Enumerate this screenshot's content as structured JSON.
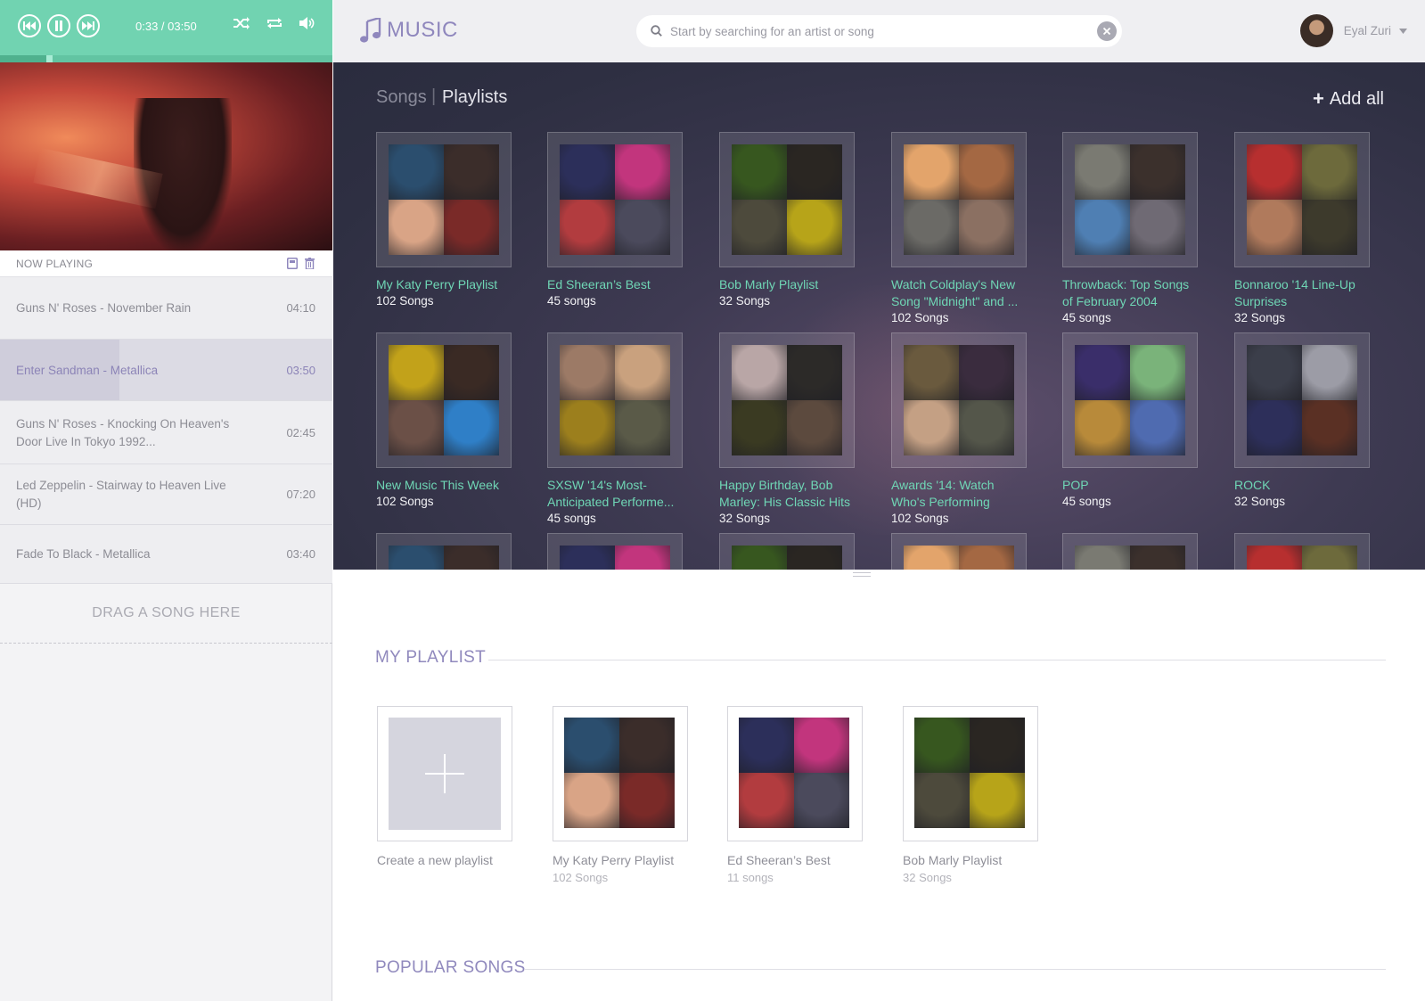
{
  "player": {
    "time": "0:33 / 03:50",
    "progress": 0.14
  },
  "now_playing": {
    "label": "NOW PLAYING"
  },
  "queue": [
    {
      "title": "Guns N' Roses - November Rain",
      "duration": "04:10",
      "active": false,
      "progress": 0
    },
    {
      "title": "Enter Sandman - Metallica",
      "duration": "03:50",
      "active": true,
      "progress": 0.36
    },
    {
      "title": "Guns N' Roses - Knocking On Heaven's Door Live In Tokyo 1992...",
      "duration": "02:45",
      "active": false,
      "progress": 0
    },
    {
      "title": "Led Zeppelin - Stairway to Heaven Live (HD)",
      "duration": "07:20",
      "active": false,
      "progress": 0
    },
    {
      "title": "Fade To Black - Metallica",
      "duration": "03:40",
      "active": false,
      "progress": 0
    }
  ],
  "drop_zone": "DRAG A SONG HERE",
  "header": {
    "logo_text": "MUSIC",
    "search_placeholder": "Start by searching for an artist or song",
    "search_value": "",
    "user_name": "Eyal Zuri"
  },
  "browse": {
    "tab_songs": "Songs",
    "separator": "|",
    "tab_playlists": "Playlists",
    "add_all": "Add all",
    "playlists": [
      {
        "title": "My Katy Perry Playlist",
        "count": "102 Songs",
        "colors": [
          "#2b4e6e",
          "#3b2d2a",
          "#d9a486",
          "#7a2a28"
        ]
      },
      {
        "title": "Ed Sheeran’s Best",
        "count": "45 songs",
        "colors": [
          "#2c2f5a",
          "#c2357d",
          "#b23c3f",
          "#4b4a5c"
        ]
      },
      {
        "title": "Bob Marly Playlist",
        "count": "32 Songs",
        "colors": [
          "#37571f",
          "#2a2622",
          "#4d4a3c",
          "#b7a419"
        ]
      },
      {
        "title": "Watch Coldplay's New Song \"Midnight\" and ...",
        "count": "102 Songs",
        "colors": [
          "#e3a46b",
          "#a46843",
          "#6b6a66",
          "#8b7062"
        ]
      },
      {
        "title": "Throwback: Top Songs of February 2004",
        "count": "45 songs",
        "colors": [
          "#7a7a72",
          "#3b302c",
          "#4f7fb3",
          "#6f6a74"
        ]
      },
      {
        "title": "Bonnaroo '14 Line-Up Surprises",
        "count": "32 Songs",
        "colors": [
          "#b72f2f",
          "#6d6a3c",
          "#b07a5c",
          "#3d3a2c"
        ]
      },
      {
        "title": "New Music This Week",
        "count": "102 Songs",
        "colors": [
          "#c2a21a",
          "#3a2a24",
          "#6b5047",
          "#2f7fc7"
        ]
      },
      {
        "title": "SXSW '14's Most-Anticipated Performe...",
        "count": "45 songs",
        "colors": [
          "#9c7a66",
          "#c9a17e",
          "#9c7f1d",
          "#5a5a48"
        ]
      },
      {
        "title": "Happy Birthday, Bob Marley: His Classic Hits",
        "count": "32 Songs",
        "colors": [
          "#b9a6a6",
          "#2c2a28",
          "#3a3a22",
          "#5c4a3e"
        ]
      },
      {
        "title": "Awards '14: Watch Who's Performing",
        "count": "102 Songs",
        "colors": [
          "#6a5a3e",
          "#3a2c3e",
          "#c4a084",
          "#54564a"
        ]
      },
      {
        "title": "POP",
        "count": "45 songs",
        "colors": [
          "#3a2e6a",
          "#7ab37a",
          "#b88a3a",
          "#4f6bb0"
        ]
      },
      {
        "title": "ROCK",
        "count": "32 Songs",
        "colors": [
          "#3b3e4a",
          "#9c9ca6",
          "#2d2f5a",
          "#5a3024"
        ]
      }
    ]
  },
  "my_playlist": {
    "section_title": "MY PLAYLIST",
    "create_label": "Create a new playlist",
    "items": [
      {
        "title": "My Katy Perry Playlist",
        "count": "102 Songs",
        "colors": [
          "#2b4e6e",
          "#3b2d2a",
          "#d9a486",
          "#7a2a28"
        ]
      },
      {
        "title": "Ed Sheeran’s Best",
        "count": "11 songs",
        "colors": [
          "#2c2f5a",
          "#c2357d",
          "#b23c3f",
          "#4b4a5c"
        ]
      },
      {
        "title": "Bob Marly Playlist",
        "count": "32 Songs",
        "colors": [
          "#37571f",
          "#2a2622",
          "#4d4a3c",
          "#b7a419"
        ]
      }
    ]
  },
  "popular": {
    "section_title": "POPULAR SONGS"
  },
  "colors": {
    "accent_green": "#71d3b1",
    "accent_purple": "#8f87bd",
    "playlist_title": "#6fd6b5"
  }
}
